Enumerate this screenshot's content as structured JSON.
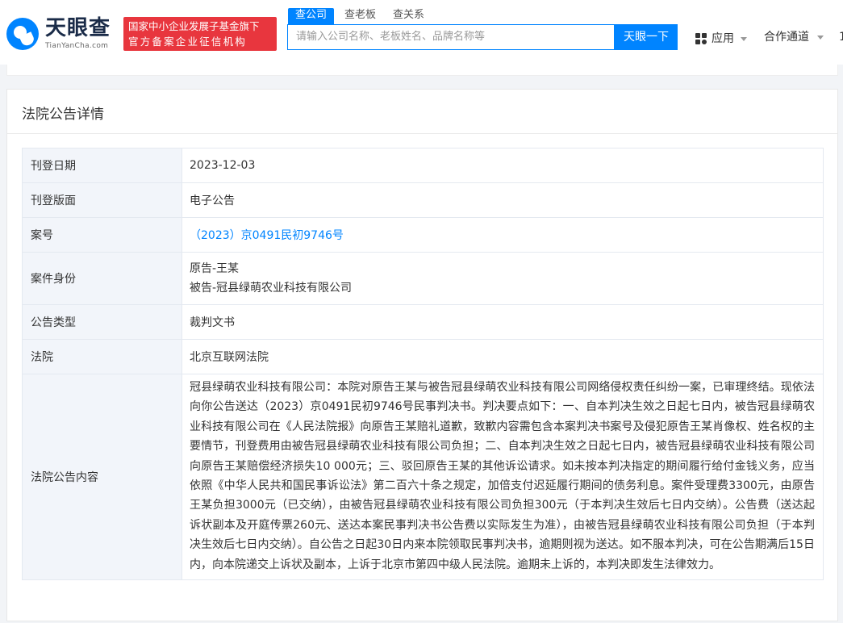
{
  "header": {
    "logo_cn": "天眼查",
    "logo_en": "TianYanCha.com",
    "badge_line1": "国家中小企业发展子基金旗下",
    "badge_line2": "官方备案企业征信机构",
    "tabs": [
      {
        "label": "查公司",
        "active": true
      },
      {
        "label": "查老板",
        "active": false
      },
      {
        "label": "查关系",
        "active": false
      }
    ],
    "search_placeholder": "请输入公司名称、老板姓名、品牌名称等",
    "search_button": "天眼一下",
    "nav_apps": "应用",
    "nav_coop": "合作通道",
    "edge_char": "1"
  },
  "page": {
    "title": "法院公告详情"
  },
  "details": {
    "publish_date_label": "刊登日期",
    "publish_date": "2023-12-03",
    "edition_label": "刊登版面",
    "edition": "电子公告",
    "case_no_label": "案号",
    "case_no": "（2023）京0491民初9746号",
    "party_label": "案件身份",
    "plaintiff": "原告-王某",
    "defendant": "被告-冠县绿萌农业科技有限公司",
    "type_label": "公告类型",
    "type": "裁判文书",
    "court_label": "法院",
    "court": "北京互联网法院",
    "content_label": "法院公告内容",
    "content": "冠县绿萌农业科技有限公司：本院对原告王某与被告冠县绿萌农业科技有限公司网络侵权责任纠纷一案，已审理终结。现依法向你公告送达（2023）京0491民初9746号民事判决书。判决要点如下：一、自本判决生效之日起七日内，被告冠县绿萌农业科技有限公司在《人民法院报》向原告王某赔礼道歉，致歉内容需包含本案判决书案号及侵犯原告王某肖像权、姓名权的主要情节，刊登费用由被告冠县绿萌农业科技有限公司负担；二、自本判决生效之日起七日内，被告冠县绿萌农业科技有限公司向原告王某赔偿经济损失10 000元；三、驳回原告王某的其他诉讼请求。如未按本判决指定的期间履行给付金钱义务，应当依照《中华人民共和国民事诉讼法》第二百六十条之规定，加倍支付迟延履行期间的债务利息。案件受理费3300元，由原告王某负担3000元（已交纳），由被告冠县绿萌农业科技有限公司负担300元（于本判决生效后七日内交纳）。公告费（送达起诉状副本及开庭传票260元、送达本案民事判决书公告费以实际发生为准），由被告冠县绿萌农业科技有限公司负担（于本判决生效后七日内交纳）。自公告之日起30日内来本院领取民事判决书，逾期则视为送达。如不服本判决，可在公告期满后15日内，向本院递交上诉状及副本，上诉于北京市第四中级人民法院。逾期未上诉的，本判决即发生法律效力。"
  },
  "colors": {
    "brand_blue": "#0084ff",
    "badge_red": "#e8363e",
    "label_bg": "#f2f5fa"
  }
}
